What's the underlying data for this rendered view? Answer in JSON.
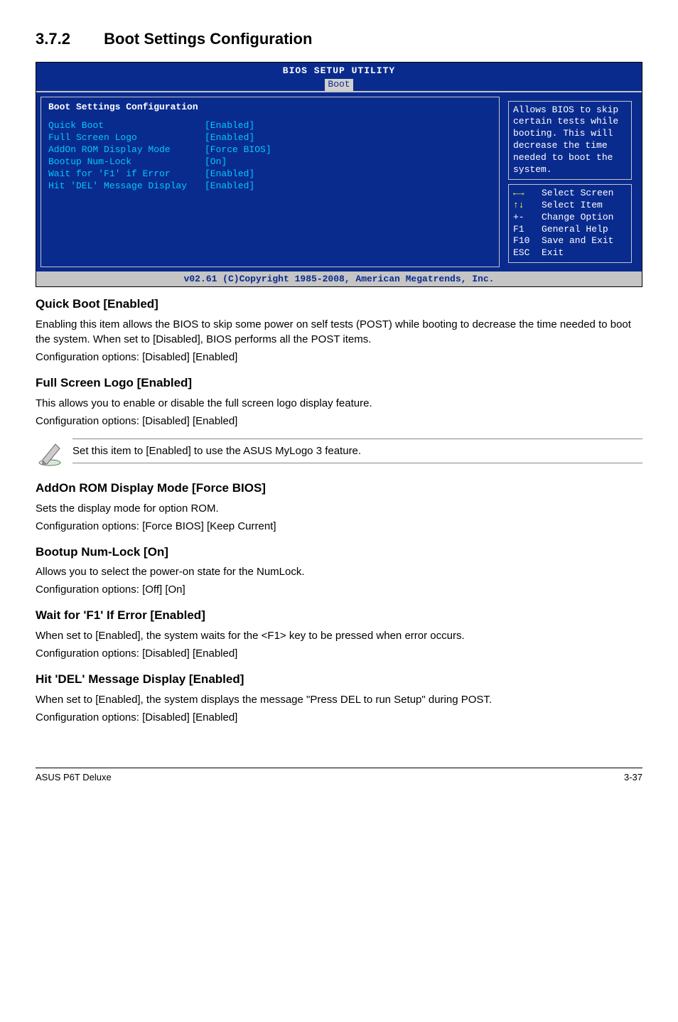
{
  "heading": {
    "number": "3.7.2",
    "title": "Boot Settings Configuration"
  },
  "bios": {
    "utility_title": "BIOS SETUP UTILITY",
    "tab": "Boot",
    "panel_title": "Boot Settings Configuration",
    "rows": [
      {
        "label": "Quick Boot",
        "value": "[Enabled]"
      },
      {
        "label": "Full Screen Logo",
        "value": "[Enabled]"
      },
      {
        "label": "AddOn ROM Display Mode",
        "value": "[Force BIOS]"
      },
      {
        "label": "Bootup Num-Lock",
        "value": "[On]"
      },
      {
        "label": "Wait for 'F1' if Error",
        "value": "[Enabled]"
      },
      {
        "label": "Hit 'DEL' Message Display",
        "value": "[Enabled]"
      }
    ],
    "help_text": "Allows BIOS to skip certain tests while booting. This will decrease the time needed to boot the system.",
    "keys": [
      {
        "k": "←→",
        "d": "Select Screen"
      },
      {
        "k": "↑↓",
        "d": "Select Item"
      },
      {
        "k": "+-",
        "d": "Change Option"
      },
      {
        "k": "F1",
        "d": "General Help"
      },
      {
        "k": "F10",
        "d": "Save and Exit"
      },
      {
        "k": "ESC",
        "d": "Exit"
      }
    ],
    "footer": "v02.61 (C)Copyright 1985-2008, American Megatrends, Inc."
  },
  "sections": {
    "quickboot": {
      "title": "Quick Boot [Enabled]",
      "body": "Enabling this item allows the BIOS to skip some power on self tests (POST) while booting to decrease the time needed to boot the system. When set to [Disabled], BIOS performs all the POST items.",
      "opts": "Configuration options: [Disabled] [Enabled]"
    },
    "fullscreen": {
      "title": "Full Screen Logo [Enabled]",
      "body": "This allows you to enable or disable the full screen logo display feature.",
      "opts": "Configuration options: [Disabled] [Enabled]"
    },
    "note": "Set this item to [Enabled] to use the ASUS MyLogo 3 feature.",
    "addon": {
      "title": "AddOn ROM Display Mode [Force BIOS]",
      "body": "Sets the display mode for option ROM.",
      "opts": "Configuration options: [Force BIOS] [Keep Current]"
    },
    "numlock": {
      "title": "Bootup Num-Lock [On]",
      "body": "Allows you to select the power-on state for the NumLock.",
      "opts": "Configuration options: [Off] [On]"
    },
    "waitf1": {
      "title": "Wait for 'F1' If Error [Enabled]",
      "body": "When set to [Enabled], the system waits for the <F1> key to be pressed when error occurs.",
      "opts": "Configuration options: [Disabled] [Enabled]"
    },
    "hitdel": {
      "title": "Hit 'DEL' Message Display [Enabled]",
      "body": "When set to [Enabled], the system displays the message \"Press DEL to run Setup\" during POST.",
      "opts": "Configuration options: [Disabled] [Enabled]"
    }
  },
  "footer": {
    "left": "ASUS P6T Deluxe",
    "right": "3-37"
  }
}
